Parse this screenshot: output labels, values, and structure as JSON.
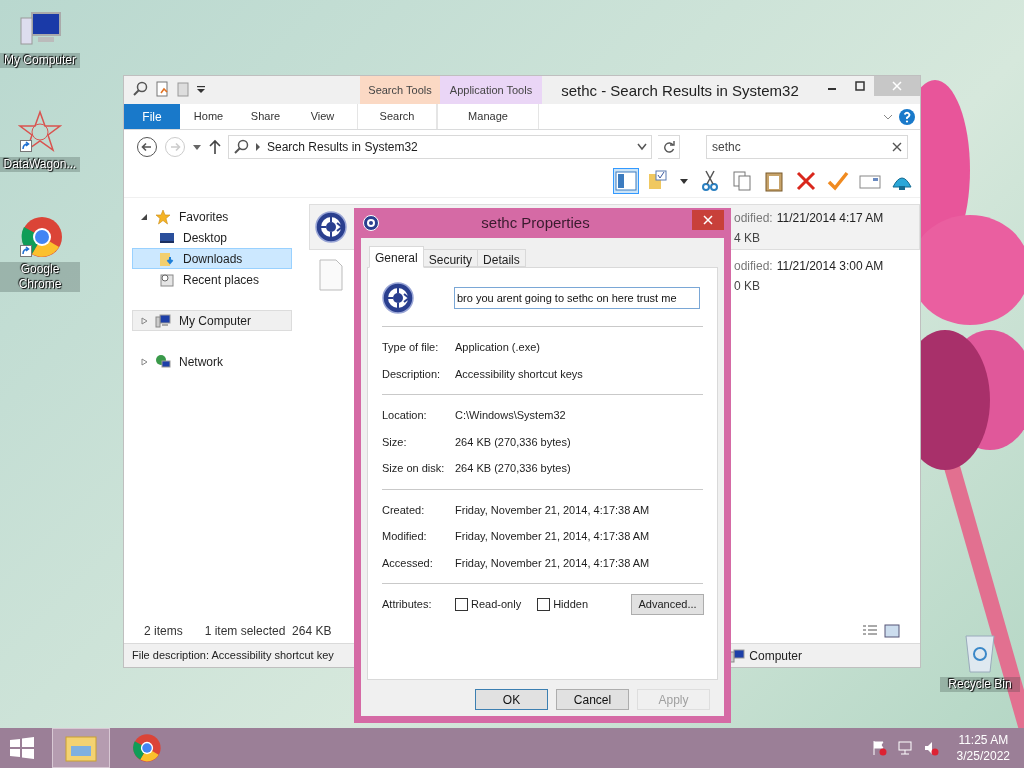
{
  "desktop_icons": [
    {
      "label": "My Computer",
      "kind": "computer"
    },
    {
      "label": "DataWagon...",
      "kind": "star"
    },
    {
      "label": "Google Chrome",
      "kind": "chrome"
    },
    {
      "label": "Recycle Bin",
      "kind": "bin"
    }
  ],
  "explorer": {
    "title": "sethc - Search Results in System32",
    "contextual": [
      {
        "group": "Search Tools",
        "tab": "Search",
        "color": "#fbd9c4"
      },
      {
        "group": "Application Tools",
        "tab": "Manage",
        "color": "#ead6f6"
      }
    ],
    "tabs": [
      {
        "label": "File",
        "kind": "file"
      },
      {
        "label": "Home",
        "kind": "plain"
      },
      {
        "label": "Share",
        "kind": "plain"
      },
      {
        "label": "View",
        "kind": "plain"
      }
    ],
    "address": "Search Results in System32",
    "search_value": "sethc",
    "nav": [
      {
        "label": "Favorites",
        "kind": "star",
        "selected": false,
        "hover": false,
        "expanded": true,
        "children": [
          {
            "label": "Desktop",
            "kind": "desktop",
            "selected": false,
            "hover": false
          },
          {
            "label": "Downloads",
            "kind": "downloads",
            "selected": true,
            "hover": false
          },
          {
            "label": "Recent places",
            "kind": "recent",
            "selected": false,
            "hover": false
          }
        ]
      },
      {
        "label": "My Computer",
        "kind": "computer",
        "selected": false,
        "hover": true,
        "expanded": false
      },
      {
        "label": "Network",
        "kind": "network",
        "selected": false,
        "hover": false,
        "expanded": false
      }
    ],
    "files": [
      {
        "kind": "app",
        "selected": true,
        "modified_label": "odified:",
        "modified": "11/21/2014 4:17 AM",
        "size": "4 KB"
      },
      {
        "kind": "doc",
        "selected": false,
        "modified_label": "odified:",
        "modified": "11/21/2014 3:00 AM",
        "size": "0 KB"
      }
    ],
    "status": {
      "count": "2 items",
      "selection": "1 item selected  264 KB"
    },
    "details": {
      "description": "File description: Accessibility shortcut key",
      "location": "Computer"
    }
  },
  "dialog": {
    "title": "sethc Properties",
    "tabs": [
      {
        "label": "General",
        "selected": true
      },
      {
        "label": "Security",
        "selected": false
      },
      {
        "label": "Details",
        "selected": false
      }
    ],
    "name_value": "bro you arent going to sethc on here trust me",
    "groups": [
      [
        {
          "label": "Type of file:",
          "value": "Application (.exe)"
        },
        {
          "label": "Description:",
          "value": "Accessibility shortcut keys"
        }
      ],
      [
        {
          "label": "Location:",
          "value": "C:\\Windows\\System32"
        },
        {
          "label": "Size:",
          "value": "264 KB (270,336 bytes)"
        },
        {
          "label": "Size on disk:",
          "value": "264 KB (270,336 bytes)"
        }
      ],
      [
        {
          "label": "Created:",
          "value": "Friday, November 21, 2014, 4:17:38 AM"
        },
        {
          "label": "Modified:",
          "value": "Friday, November 21, 2014, 4:17:38 AM"
        },
        {
          "label": "Accessed:",
          "value": "Friday, November 21, 2014, 4:17:38 AM"
        }
      ]
    ],
    "attributes": {
      "label": "Attributes:",
      "checkboxes": [
        {
          "label": "Read-only",
          "checked": false
        },
        {
          "label": "Hidden",
          "checked": false
        }
      ],
      "advanced": "Advanced..."
    },
    "buttons": [
      {
        "label": "OK",
        "disabled": false,
        "default": true
      },
      {
        "label": "Cancel",
        "disabled": false,
        "default": false
      },
      {
        "label": "Apply",
        "disabled": true,
        "default": false
      }
    ]
  },
  "taskbar": {
    "apps": [
      {
        "kind": "explorer",
        "selected": true
      },
      {
        "kind": "chrome",
        "selected": false
      }
    ],
    "time": "11:25 AM",
    "date": "3/25/2022"
  }
}
